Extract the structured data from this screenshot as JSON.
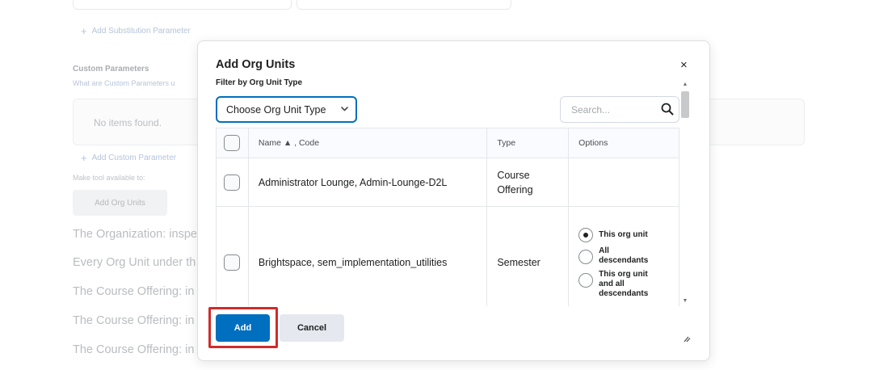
{
  "background": {
    "add_substitution_label": "Add Substitution Parameter",
    "custom_params_title": "Custom Parameters",
    "custom_params_help": "What are Custom Parameters u",
    "no_items": "No items found.",
    "add_custom_label": "Add Custom Parameter",
    "make_available_label": "Make tool available to:",
    "add_org_units_label": "Add Org Units",
    "org_lines": [
      "The Organization: inspe",
      "Every Org Unit under th",
      "The Course Offering: in",
      "The Course Offering: in",
      "The Course Offering: in"
    ]
  },
  "dialog": {
    "title": "Add Org Units",
    "close_glyph": "×",
    "filter_label": "Filter by Org Unit Type",
    "type_select": "Choose Org Unit Type",
    "search_placeholder": "Search...",
    "table": {
      "header_name": "Name ▲ , Code",
      "header_type": "Type",
      "header_options": "Options",
      "rows": [
        {
          "name": "Administrator Lounge, Admin-Lounge-D2L",
          "type_line1": "Course",
          "type_line2": "Offering"
        },
        {
          "name": "Brightspace, sem_implementation_utilities",
          "type": "Semester",
          "options": [
            {
              "label": "This org unit",
              "selected": true
            },
            {
              "label_line1": "All",
              "label_line2": "descendants",
              "selected": false
            },
            {
              "label_line1": "This org unit",
              "label_line2": "and all",
              "label_line3": "descendants",
              "selected": false
            }
          ]
        }
      ]
    },
    "add_label": "Add",
    "cancel_label": "Cancel"
  },
  "colors": {
    "primary": "#006fbf",
    "highlight": "#d02b2b",
    "cancel_bg": "#e5e9ef"
  }
}
